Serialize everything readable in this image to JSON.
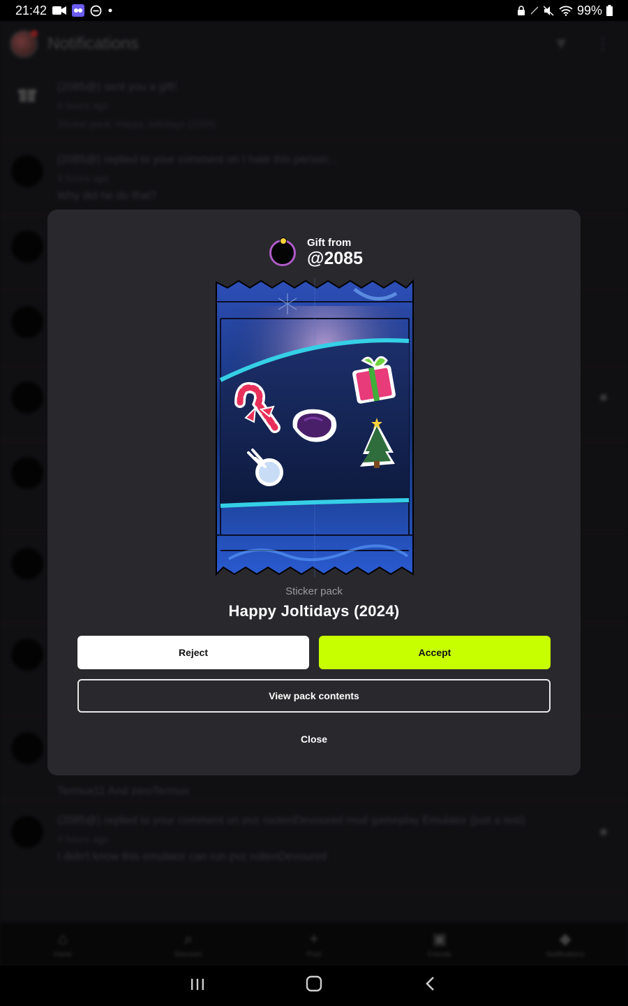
{
  "status_bar": {
    "time": "21:42",
    "battery": "99%",
    "left_icons": [
      "video-record-icon",
      "app-icon",
      "do-not-disturb-icon",
      "dot-icon"
    ],
    "right_icons": [
      "lock-icon",
      "pen-icon",
      "mute-icon",
      "wifi-icon",
      "battery-icon"
    ]
  },
  "app": {
    "title": "Notifications",
    "notifications": [
      {
        "user": "(2085@)",
        "action": "sent you a gift!",
        "time": "4 hours ago",
        "detail": "Sticker pack: Happy Joltidays (2024)"
      },
      {
        "user": "(2085@)",
        "action": "replied to your comment on I hate this person...",
        "time": "4 hours ago",
        "detail": "Why did he do that?"
      },
      {
        "user": "",
        "action": "",
        "time": "",
        "detail": ""
      },
      {
        "user": "",
        "action": "",
        "time": "",
        "detail": ""
      },
      {
        "user": "",
        "action": "",
        "time": "",
        "detail": ""
      },
      {
        "user": "",
        "action": "",
        "time": "",
        "detail": ""
      },
      {
        "user": "",
        "action": "",
        "time": "",
        "detail": ""
      },
      {
        "user": "",
        "action": "",
        "time": "",
        "detail": ""
      },
      {
        "user": "",
        "action": "",
        "time": "",
        "detail": "Termux11 And zeroTermux"
      },
      {
        "user": "(2085@)",
        "action": "replied to your comment on pvz rootenDevoured mod gameplay Emulator (just a test)",
        "time": "4 hours ago",
        "detail": "I didn't know this emulator can run pvz rottenDevoured"
      }
    ],
    "tabs": [
      {
        "label": "Home",
        "icon": "home-icon"
      },
      {
        "label": "Discover",
        "icon": "search-icon"
      },
      {
        "label": "Post",
        "icon": "plus-icon"
      },
      {
        "label": "Friends",
        "icon": "chat-icon"
      },
      {
        "label": "Notifications",
        "icon": "bell-icon"
      }
    ]
  },
  "modal": {
    "gift_from_label": "Gift from",
    "gift_from_user": "@2085",
    "pack_type": "Sticker pack",
    "pack_name": "Happy Joltidays (2024)",
    "reject_label": "Reject",
    "accept_label": "Accept",
    "view_label": "View pack contents",
    "close_label": "Close",
    "accent_color": "#c8ff00",
    "stickers": [
      "candy-cane-sticker",
      "gift-box-sticker",
      "purple-stone-sticker",
      "christmas-tree-sticker",
      "snowball-sticker"
    ]
  },
  "nav_bar": {
    "recents_icon": "recents-icon",
    "home_icon": "home-circle-icon",
    "back_icon": "back-icon"
  }
}
